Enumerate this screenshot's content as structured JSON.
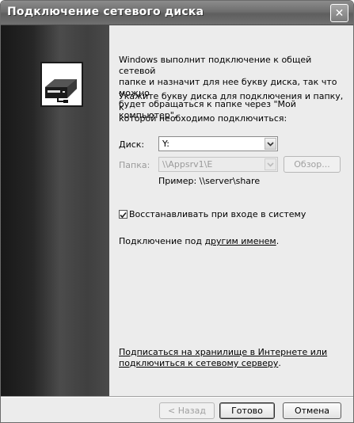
{
  "window": {
    "title": "Подключение сетевого диска",
    "close_glyph": "✕"
  },
  "intro": {
    "line1": "Windows выполнит подключение к общей сетевой",
    "line2": "папке и назначит для нее букву диска, так что можно",
    "line3": "будет обращаться к папке через \"Мой компьютер\".",
    "line4": "Укажите букву диска для подключения и папку, к",
    "line5": "которой необходимо подключиться:"
  },
  "drive": {
    "label": "Диск:",
    "value": "Y:"
  },
  "folder": {
    "label": "Папка:",
    "value": "\\\\Appsrv1\\E",
    "browse_label": "Обзор..."
  },
  "example": "Пример: \\\\server\\share",
  "reconnect": {
    "label": "Восстанавливать при входе в систему",
    "checked": true
  },
  "connect_as": {
    "prefix": "Подключение под ",
    "link": "другим именем",
    "suffix": "."
  },
  "storage_link": {
    "line1": "Подписаться на хранилище в Интернете или",
    "line2": "подключиться к сетевому серверу",
    "suffix": "."
  },
  "buttons": {
    "back": "< Назад",
    "finish": "Готово",
    "cancel": "Отмена"
  },
  "icons": {
    "drive": "network-drive-icon",
    "dropdown": "chevron-down-icon",
    "checkbox": "checkmark-icon"
  }
}
